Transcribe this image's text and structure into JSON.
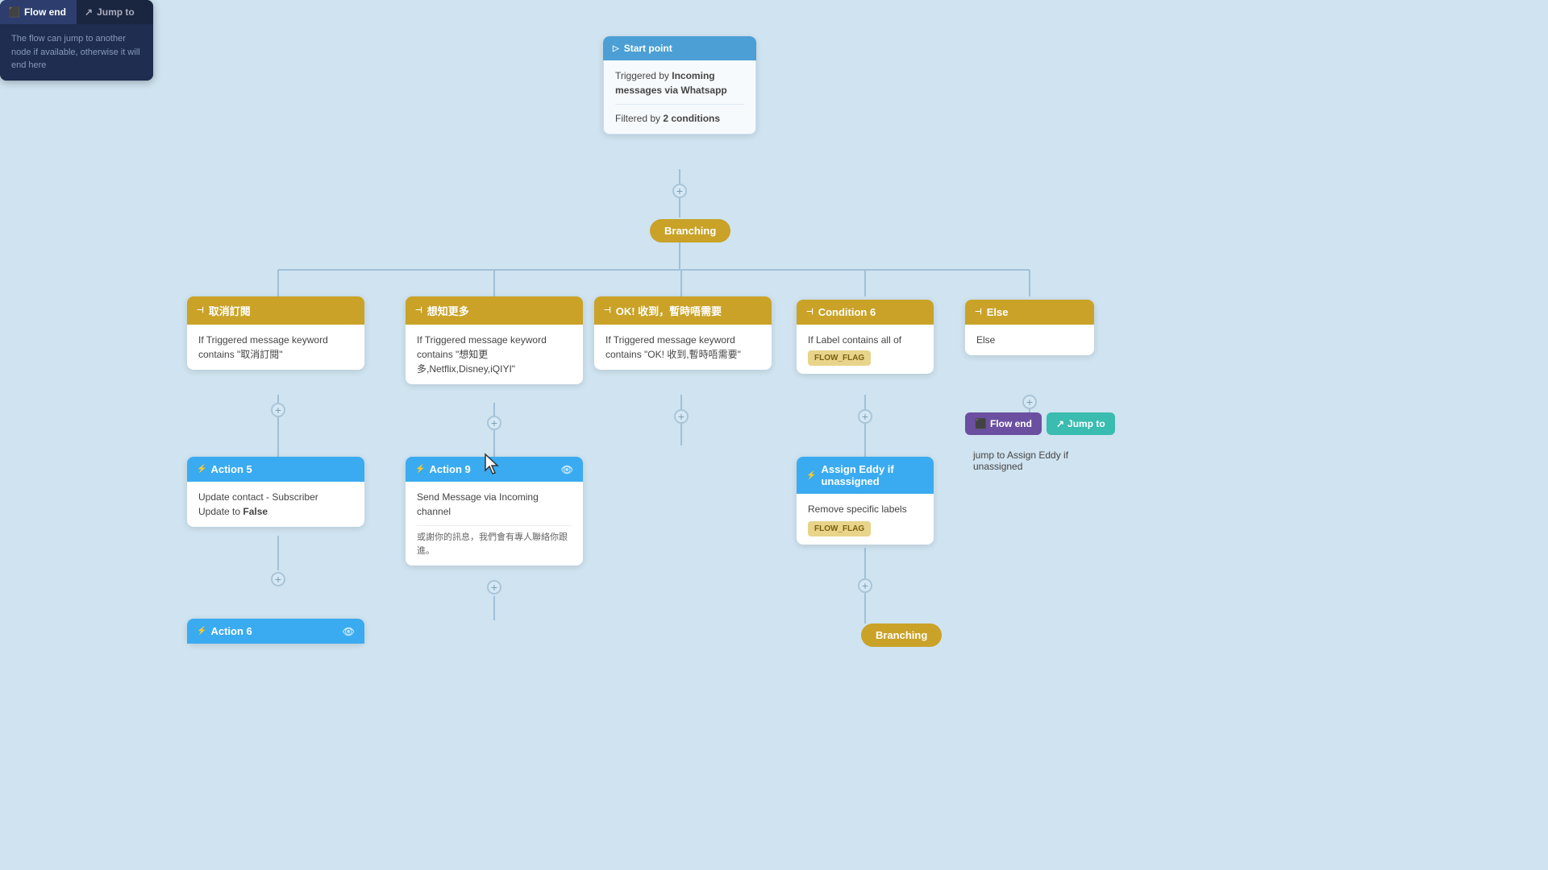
{
  "canvas": {
    "background": "#cfe3f0"
  },
  "start_point": {
    "title": "Start point",
    "trigger_label": "Triggered by",
    "trigger_value": "Incoming messages via Whatsapp",
    "filter_label": "Filtered by",
    "filter_value": "2 conditions"
  },
  "branching_main": {
    "label": "Branching"
  },
  "branching_bottom": {
    "label": "Branching"
  },
  "branch_cards": [
    {
      "id": "cancel",
      "title": "取消訂閱",
      "condition": "If Triggered message keyword contains \"取消訂閱\""
    },
    {
      "id": "more",
      "title": "想知更多",
      "condition": "If Triggered message keyword contains \"想知更多,Netflix,Disney,iQIYI\""
    },
    {
      "id": "ok",
      "title": "OK! 收到，暫時唔需要",
      "condition": "If Triggered message keyword contains \"OK! 收到,暫時唔需要\""
    },
    {
      "id": "cond6",
      "title": "Condition 6",
      "condition": "If Label contains all of",
      "badge": "FLOW_FLAG"
    },
    {
      "id": "else",
      "title": "Else",
      "condition": "Else"
    }
  ],
  "action_cards": [
    {
      "id": "action5",
      "title": "Action 5",
      "body": "Update contact - Subscriber\nUpdate to False"
    },
    {
      "id": "action9",
      "title": "Action 9",
      "body": "Send Message via Incoming channel",
      "extra": "或謝你的訊息，我們會有專人聯絡你跟進。"
    },
    {
      "id": "action6",
      "title": "Action 6",
      "body": ""
    }
  ],
  "assign_card": {
    "title": "Assign Eddy if unassigned",
    "body": "Remove specific labels",
    "badge": "FLOW_FLAG"
  },
  "flow_end": {
    "btn1": "Flow end",
    "btn2": "Jump to",
    "body": "The flow can jump to another node if available, otherwise it will end here"
  },
  "right_actions": {
    "flow_end_label": "Flow end",
    "jump_to_label": "Jump to",
    "jump_text": "jump to Assign Eddy if unassigned"
  }
}
